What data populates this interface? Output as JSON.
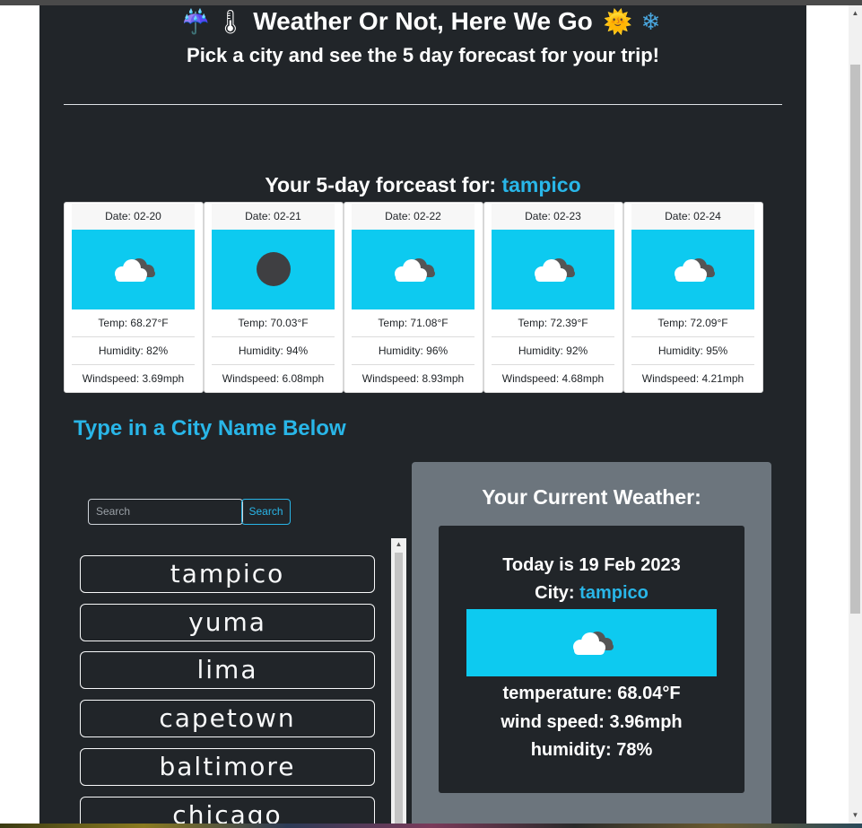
{
  "header": {
    "emoji_left": [
      "☔",
      "🌡"
    ],
    "title": "Weather Or Not, Here We Go",
    "emoji_right": [
      "🌞",
      "❄"
    ],
    "subtitle": "Pick a city and see the 5 day forecast for your trip!"
  },
  "forecast": {
    "heading_prefix": "Your 5-day forceast for:",
    "city": "tampico",
    "days": [
      {
        "date": "Date: 02-20",
        "icon": "cloud-icon",
        "temp": "Temp: 68.27°F",
        "humidity": "Humidity: 82%",
        "wind": "Windspeed: 3.69mph"
      },
      {
        "date": "Date: 02-21",
        "icon": "moon-icon",
        "temp": "Temp: 70.03°F",
        "humidity": "Humidity: 94%",
        "wind": "Windspeed: 6.08mph"
      },
      {
        "date": "Date: 02-22",
        "icon": "cloud-icon",
        "temp": "Temp: 71.08°F",
        "humidity": "Humidity: 96%",
        "wind": "Windspeed: 8.93mph"
      },
      {
        "date": "Date: 02-23",
        "icon": "cloud-icon",
        "temp": "Temp: 72.39°F",
        "humidity": "Humidity: 92%",
        "wind": "Windspeed: 4.68mph"
      },
      {
        "date": "Date: 02-24",
        "icon": "cloud-icon",
        "temp": "Temp: 72.09°F",
        "humidity": "Humidity: 95%",
        "wind": "Windspeed: 4.21mph"
      }
    ]
  },
  "search": {
    "heading": "Type in a City Name Below",
    "placeholder": "Search",
    "button_label": "Search"
  },
  "cities": [
    "tampico",
    "yuma",
    "lima",
    "capetown",
    "baltimore",
    "chicago"
  ],
  "current": {
    "title": "Your Current Weather:",
    "today": "Today is 19 Feb 2023",
    "city_label": "City:",
    "city": "tampico",
    "icon": "cloud-icon",
    "temperature": "temperature: 68.04°F",
    "wind": "wind speed: 3.96mph",
    "humidity": "humidity: 78%"
  },
  "colors": {
    "page_bg": "#212529",
    "accent": "#29b6e8",
    "weather_icon_bg": "#0dcaf0",
    "panel_bg": "#6c757d"
  }
}
